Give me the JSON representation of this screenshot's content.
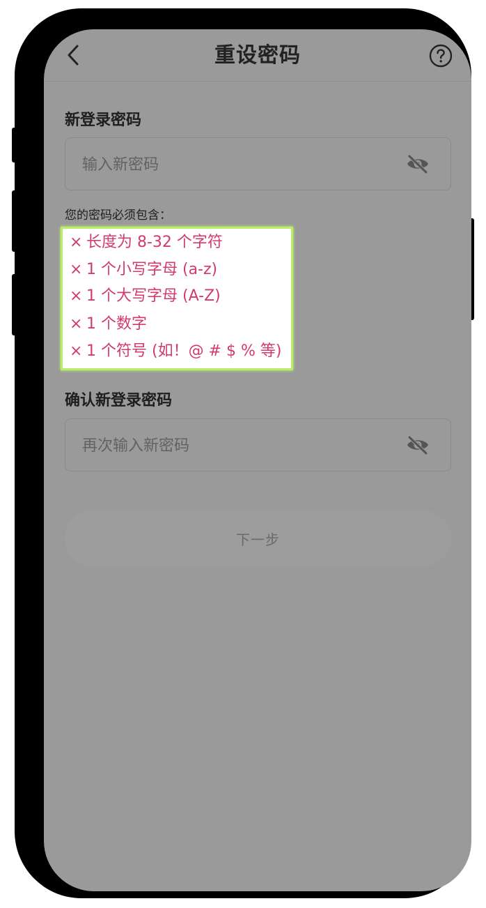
{
  "header": {
    "title": "重设密码",
    "back_icon": "chevron-left-icon",
    "help_icon": "help-circle-icon"
  },
  "new_password": {
    "label": "新登录密码",
    "placeholder": "输入新密码",
    "toggle_icon": "eye-off-icon"
  },
  "requirements": {
    "title": "您的密码必须包含：",
    "mark": "×",
    "items": [
      "长度为 8-32 个字符",
      "1 个小写字母 (a-z)",
      "1 个大写字母 (A-Z)",
      "1 个数字",
      "1 个符号 (如！@ # $ % 等)"
    ]
  },
  "confirm_password": {
    "label": "确认新登录密码",
    "placeholder": "再次输入新密码",
    "toggle_icon": "eye-off-icon"
  },
  "next_button": {
    "label": "下一步"
  },
  "colors": {
    "screen_bg": "#9a9a9a",
    "requirement_text": "#d23a6e",
    "highlight_border": "#b7ef63"
  }
}
